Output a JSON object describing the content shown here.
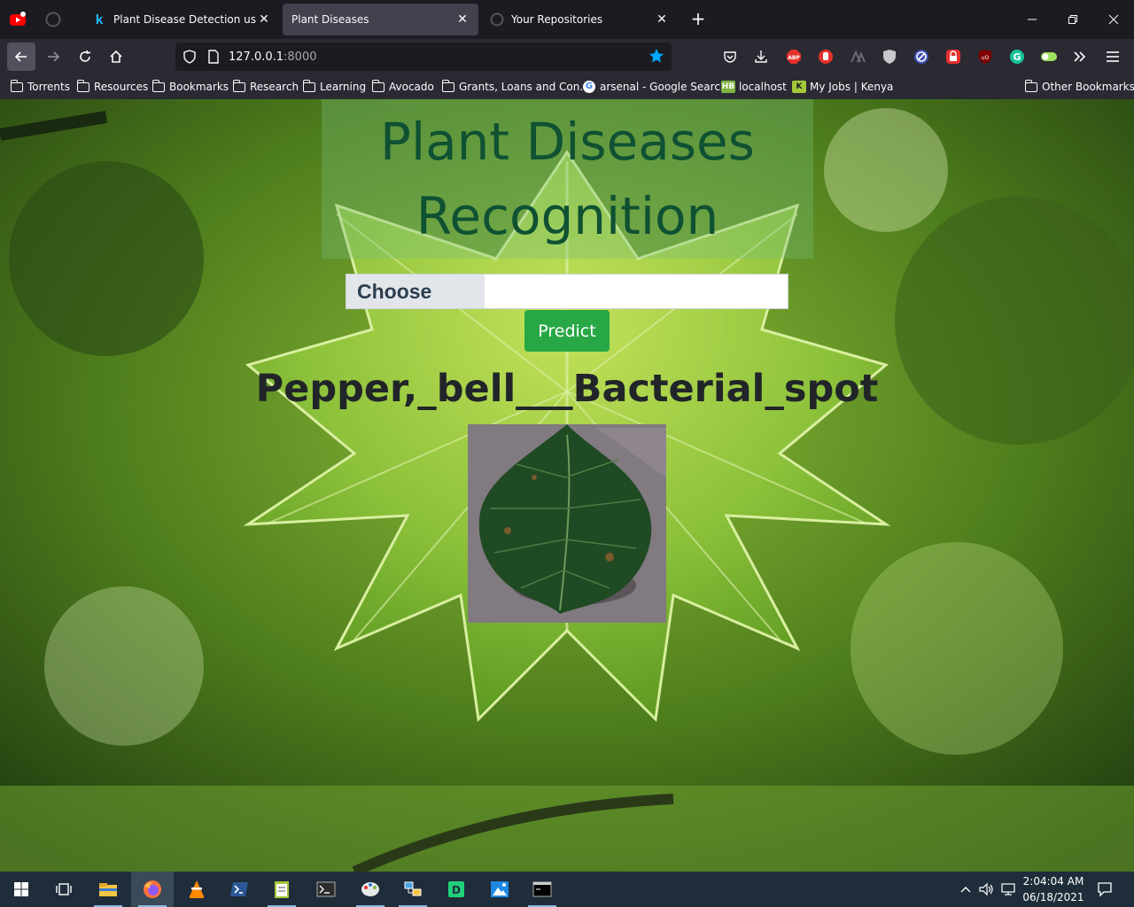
{
  "browser": {
    "tabs": [
      {
        "label": "Plant Disease Detection using Ke",
        "active": false
      },
      {
        "label": "Plant Diseases",
        "active": true
      },
      {
        "label": "Your Repositories",
        "active": false
      }
    ],
    "url_host": "127.0.0.1",
    "url_port": ":8000",
    "bookmarks": [
      {
        "label": "Torrents",
        "icon": "folder-icon"
      },
      {
        "label": "Resources",
        "icon": "folder-icon"
      },
      {
        "label": "Bookmarks",
        "icon": "folder-icon"
      },
      {
        "label": "Research",
        "icon": "folder-icon"
      },
      {
        "label": "Learning",
        "icon": "folder-icon"
      },
      {
        "label": "Avocado",
        "icon": "folder-icon"
      },
      {
        "label": "Grants, Loans and Con...",
        "icon": "folder-icon"
      },
      {
        "label": "arsenal - Google Search",
        "icon": "google-icon"
      },
      {
        "label": "localhost",
        "icon": "hb-icon"
      },
      {
        "label": "My Jobs | Kenya",
        "icon": "k-icon"
      }
    ],
    "other_bookmarks": "Other Bookmarks",
    "badges": {
      "hb": "HB",
      "k": "K",
      "abp": "ABP",
      "google": "G"
    }
  },
  "page": {
    "title": "Plant Diseases Recognition",
    "choose_label": "Choose",
    "predict_label": "Predict",
    "result": "Pepper,_bell___Bacterial_spot"
  },
  "taskbar": {
    "time": "2:04:04 AM",
    "date": "06/18/2021"
  },
  "colors": {
    "title": "#0f5132",
    "predict": "#28a745",
    "accent_star": "#00a8ff"
  }
}
